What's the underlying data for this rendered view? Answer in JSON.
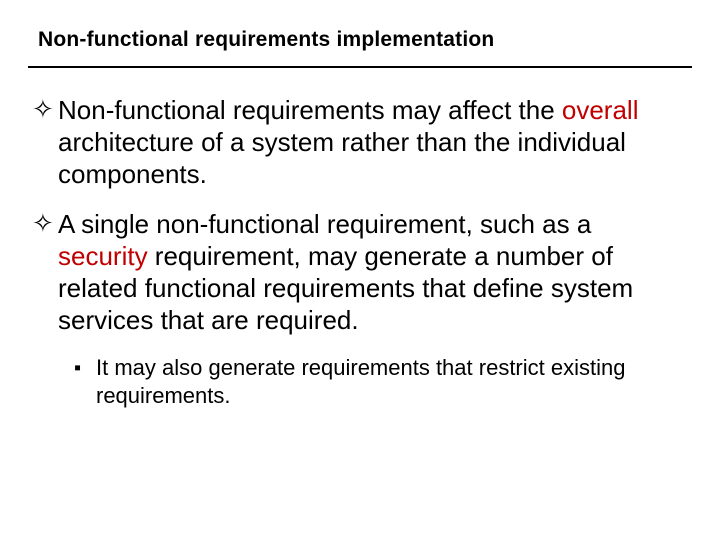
{
  "title": "Non-functional requirements implementation",
  "bullets": {
    "b1": {
      "pre": "Non-functional requirements may affect the ",
      "hl": "overall",
      "post": " architecture of a system rather than the individual components."
    },
    "b2": {
      "pre": "A single non-functional requirement, such as a ",
      "hl": "security",
      "post": " requirement, may generate a number of related functional requirements that define system services that are required."
    },
    "sub1": "It may also generate requirements that restrict existing requirements."
  },
  "markers": {
    "diamond": "✧",
    "square": "▪"
  }
}
